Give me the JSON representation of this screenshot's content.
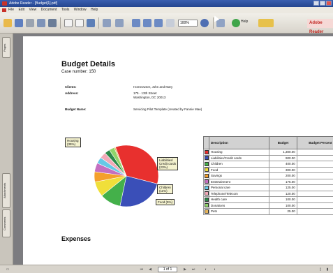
{
  "window": {
    "title": "Adobe Reader - [Budget[1].pdf]"
  },
  "menu": [
    "File",
    "Edit",
    "View",
    "Document",
    "Tools",
    "Window",
    "Help"
  ],
  "toolbar": {
    "zoom": "100%",
    "help": "Help",
    "brand": "Adobe Reader"
  },
  "nav_tabs": {
    "pages": "Pages",
    "attachments": "Attachments",
    "comments": "Comments"
  },
  "document": {
    "title": "Budget Details",
    "case_number": "Case number: 150",
    "clients_label": "Clients:",
    "clients_value": "Homeowner, John and Mary",
    "address_label": "Address:",
    "address_line1": "175 - 13th Street",
    "address_line2": "Washington, DC 20013",
    "budget_name_label": "Budget Name:",
    "budget_name_value": "Servicing Pilot Template (created by Fannie Mae)",
    "expenses_heading": "Expenses"
  },
  "pie_callouts": {
    "housing": [
      "Housing",
      "(35%)"
    ],
    "liabilities": [
      "Liabilities/",
      "Credit cards",
      "(23%)"
    ],
    "children": [
      "Children",
      "(11%)"
    ],
    "food": "Food (5%)"
  },
  "chart_data": {
    "type": "table",
    "columns": [
      "Description",
      "Budget",
      "Budget Percent"
    ],
    "rows": [
      {
        "description": "Housing",
        "budget": "1,300.00",
        "percent": "35.0",
        "color": "#e8302e"
      },
      {
        "description": "Liabilities/Credit cards",
        "budget": "900.00",
        "percent": "23.0",
        "color": "#3a4fb8"
      },
      {
        "description": "Children",
        "budget": "400.00",
        "percent": "11.0",
        "color": "#44b04a"
      },
      {
        "description": "Food",
        "budget": "300.00",
        "percent": "5.0",
        "color": "#f0df3a"
      },
      {
        "description": "Savings",
        "budget": "200.00",
        "percent": "5.0",
        "color": "#f4a02c"
      },
      {
        "description": "Entertainment",
        "budget": "175.00",
        "percent": "5.0",
        "color": "#c46fc0"
      },
      {
        "description": "Personal care",
        "budget": "125.00",
        "percent": "3.0",
        "color": "#66c8e6"
      },
      {
        "description": "Telephone/Telecom",
        "budget": "120.00",
        "percent": "3.0",
        "color": "#f2a9b8"
      },
      {
        "description": "Health care",
        "budget": "100.00",
        "percent": "3.0",
        "color": "#2c8a4a"
      },
      {
        "description": "Donations",
        "budget": "100.00",
        "percent": "3.0",
        "color": "#8fd46a"
      },
      {
        "description": "Pets",
        "budget": "25.00",
        "percent": "1.0",
        "color": "#e6b55c"
      }
    ]
  },
  "status": {
    "page_indicator": "1 of 1"
  }
}
